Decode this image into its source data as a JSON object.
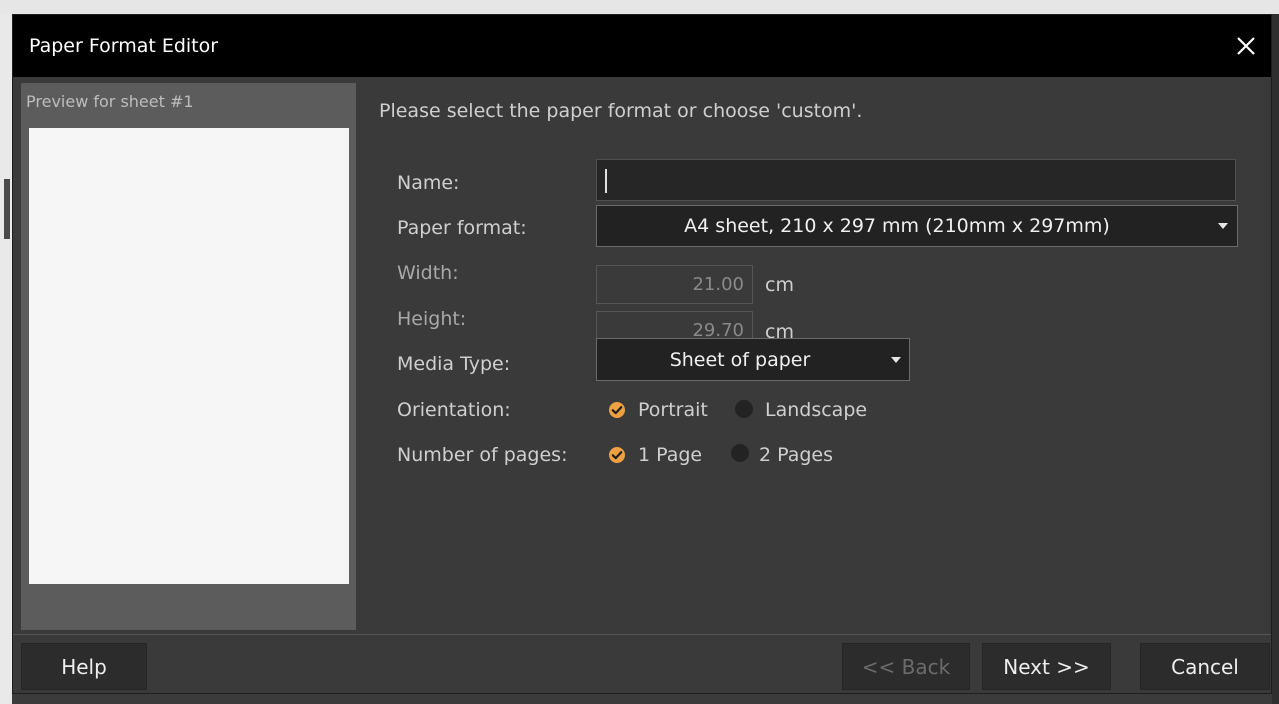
{
  "window": {
    "title": "Paper Format Editor",
    "close_icon": "close-icon"
  },
  "preview": {
    "label": "Preview for sheet #1"
  },
  "instruction": "Please select the paper format or choose 'custom'.",
  "form": {
    "name": {
      "label": "Name:",
      "value": "",
      "placeholder": ""
    },
    "paper_format": {
      "label": "Paper format:",
      "value": "A4 sheet, 210 x 297 mm (210mm x 297mm)"
    },
    "width": {
      "label": "Width:",
      "value": "21.00",
      "unit": "cm"
    },
    "height": {
      "label": "Height:",
      "value": "29.70",
      "unit": "cm"
    },
    "media_type": {
      "label": "Media Type:",
      "value": "Sheet of paper"
    },
    "orientation": {
      "label": "Orientation:",
      "options": [
        {
          "label": "Portrait",
          "checked": true
        },
        {
          "label": "Landscape",
          "checked": false
        }
      ]
    },
    "pages": {
      "label": "Number of pages:",
      "options": [
        {
          "label": "1 Page",
          "checked": true
        },
        {
          "label": "2 Pages",
          "checked": false
        }
      ]
    }
  },
  "buttons": {
    "help": "Help",
    "back": "<< Back",
    "next": "Next >>",
    "cancel": "Cancel"
  },
  "colors": {
    "accent": "#f0a040",
    "titlebar": "#000000",
    "background": "#3a3a3a"
  }
}
